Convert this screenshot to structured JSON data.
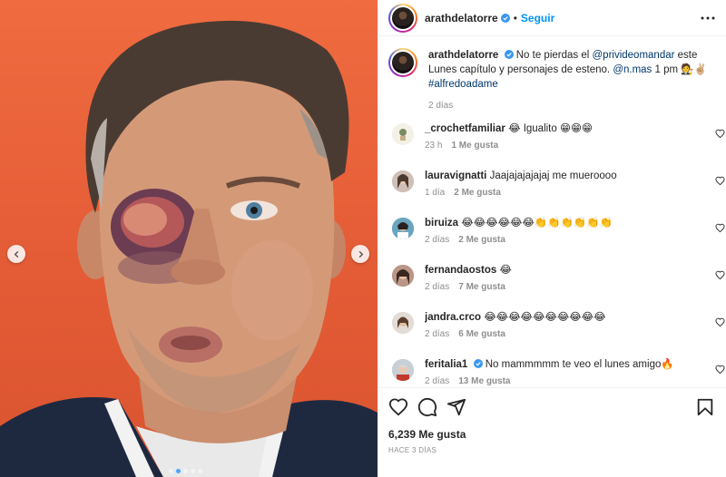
{
  "post": {
    "username": "arathdelatorre",
    "follow_label": "Seguir",
    "separator": "•",
    "caption_mention_1": "@privideomandar",
    "caption_part_1": "No te pierdas el ",
    "caption_part_2": " este Lunes capítulo y personajes de esteno. ",
    "caption_mention_2": "@n.mas",
    "caption_part_3": " 1 pm 🧑‍⚖️✌🏼",
    "caption_hashtag": "#alfredoadame",
    "caption_time": "2 días"
  },
  "comments": [
    {
      "user": "_crochetfamiliar",
      "text": "😂 Igualito 😁😁😁",
      "time": "23 h",
      "likes": "1 Me gusta"
    },
    {
      "user": "lauravignatti",
      "text": "Jaajajajajajaj me mueroooo",
      "time": "1 día",
      "likes": "2 Me gusta"
    },
    {
      "user": "biruiza",
      "text": "😂😂😂😂😂😂👏👏👏👏👏👏",
      "time": "2 días",
      "likes": "2 Me gusta"
    },
    {
      "user": "fernandaostos",
      "text": "😂",
      "time": "2 días",
      "likes": "7 Me gusta"
    },
    {
      "user": "jandra.crco",
      "text": "😂😂😂😂😂😂😂😂😂😂",
      "time": "2 días",
      "likes": "6 Me gusta"
    },
    {
      "user": "feritalia1",
      "text": "No mammmmm te veo el lunes amigo🔥",
      "time": "2 días",
      "likes": "13 Me gusta"
    }
  ],
  "footer": {
    "likes": "6,239 Me gusta",
    "posted": "HACE 3 DÍAS"
  },
  "icons": {
    "verified": "verified-badge-icon",
    "more": "more-options-icon",
    "heart": "heart-icon",
    "comment": "comment-icon",
    "share": "share-icon",
    "save": "bookmark-icon",
    "prev": "chevron-left-icon",
    "next": "chevron-right-icon"
  },
  "colors": {
    "accent": "#0095f6",
    "verified": "#3897f0",
    "muted": "#8e8e8e",
    "photo_background": "#e45c36"
  },
  "media": {
    "slide_count": 5,
    "active_slide": 1
  }
}
